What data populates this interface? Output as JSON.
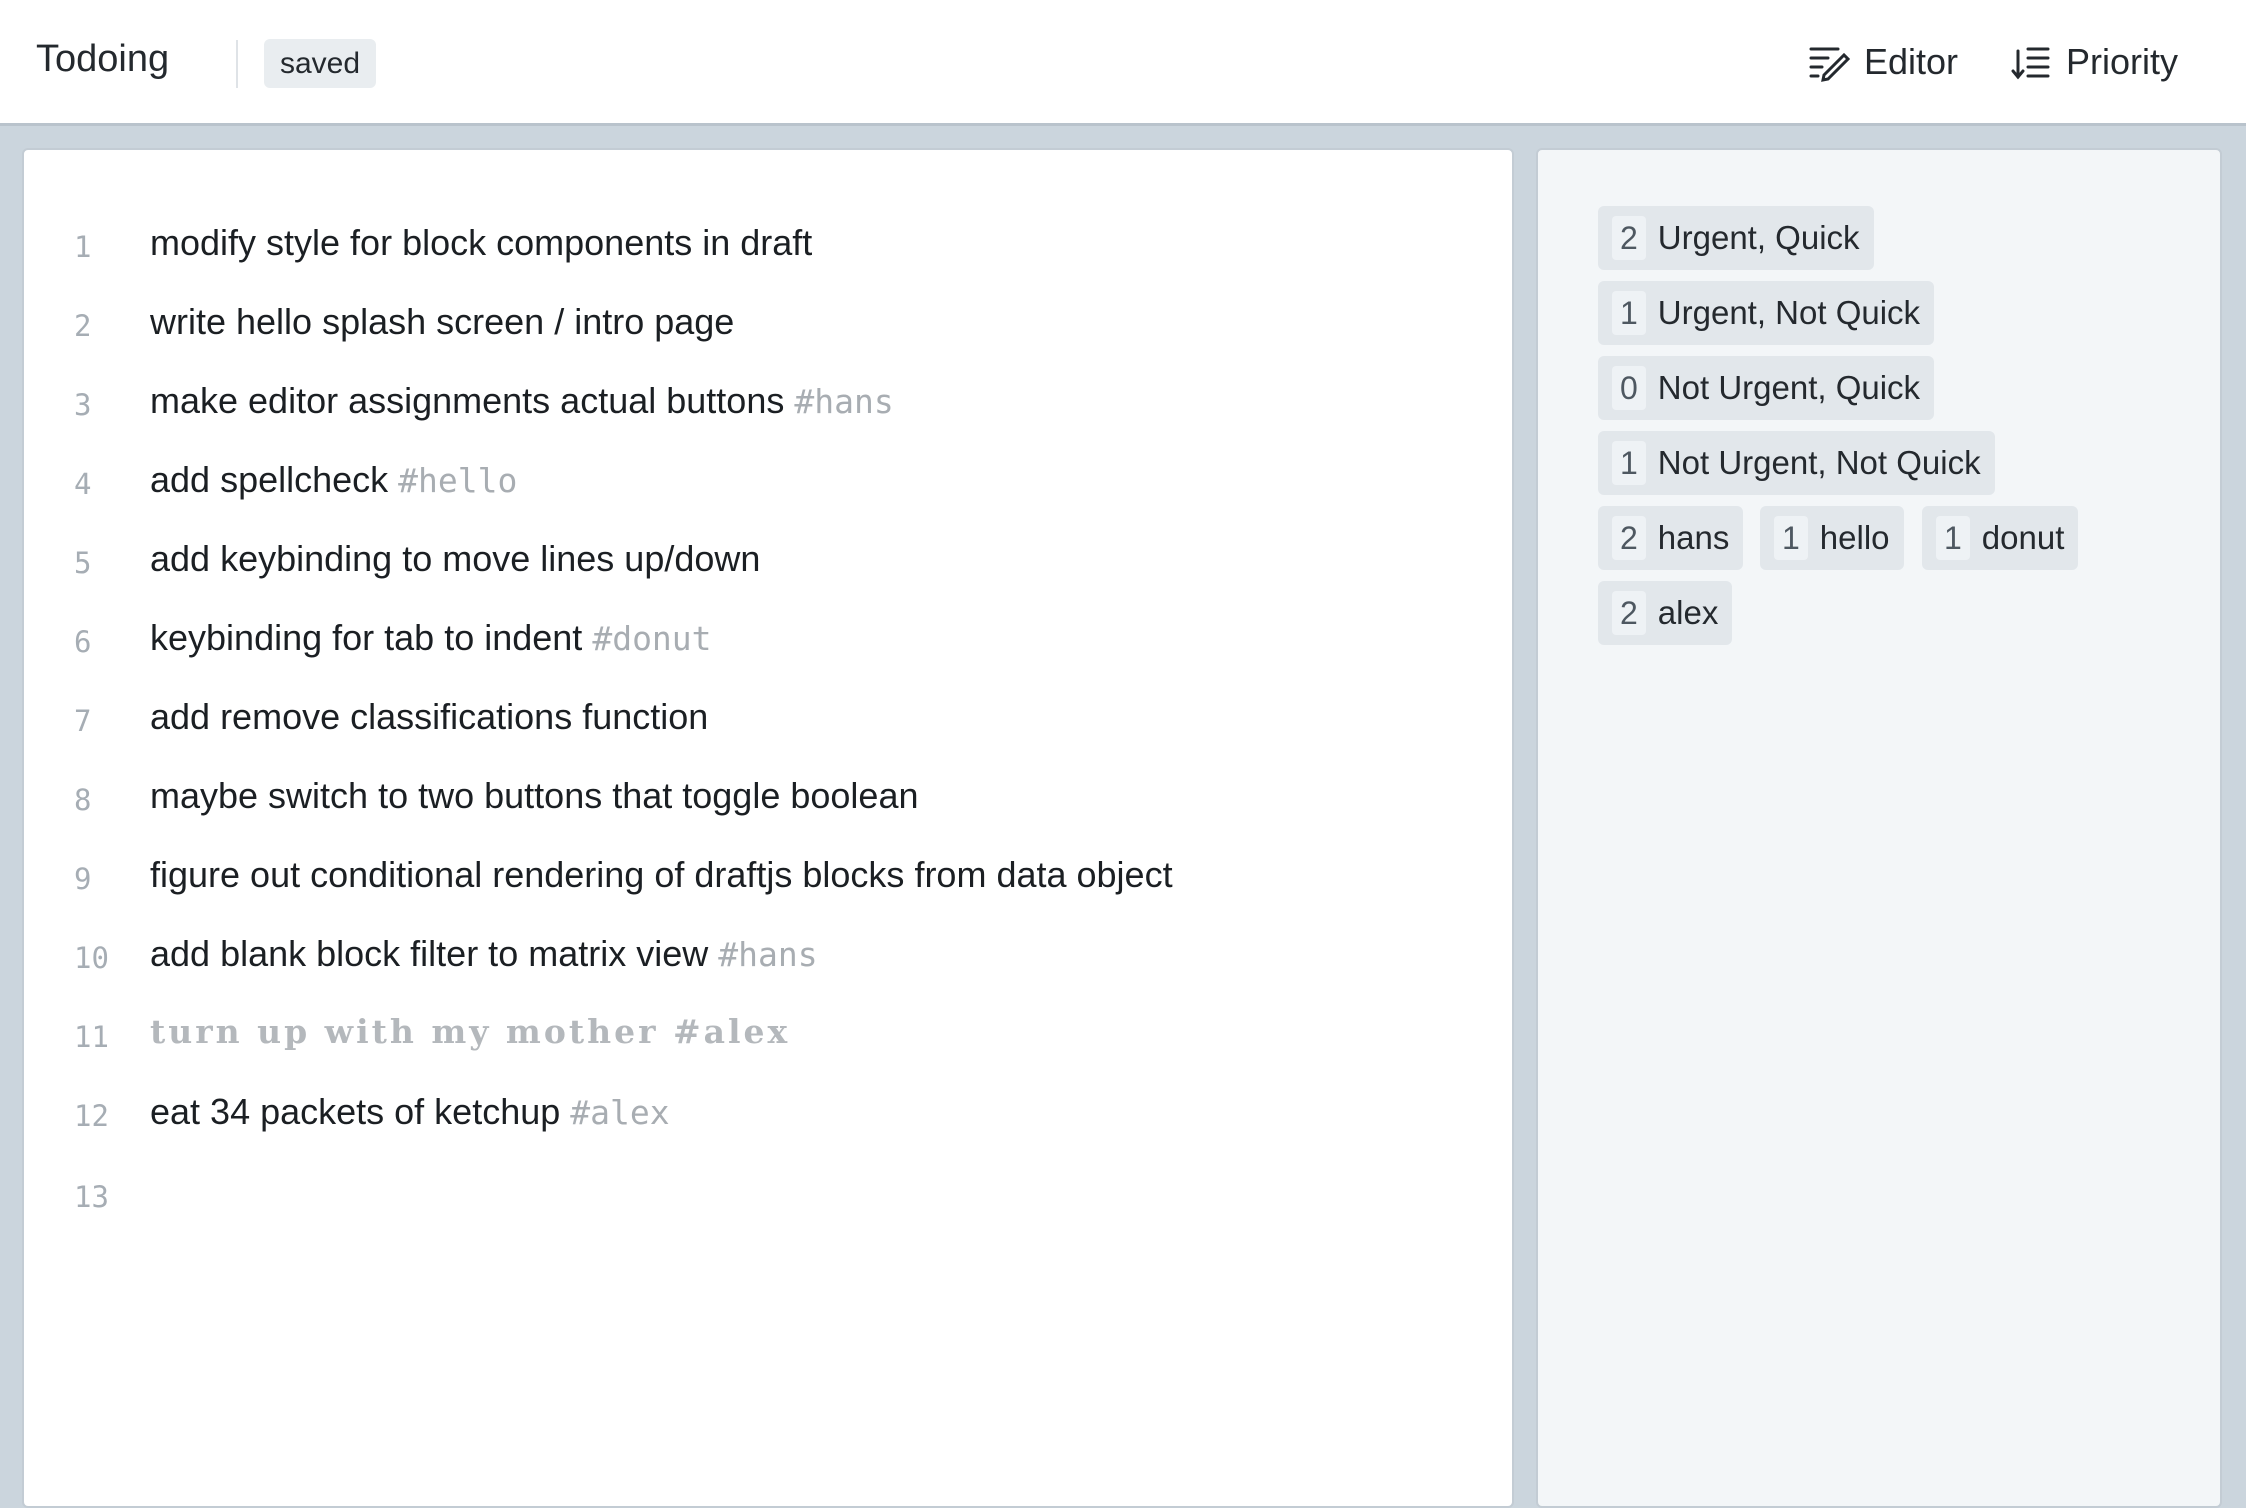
{
  "app": {
    "title": "Todoing",
    "status": "saved"
  },
  "nav": {
    "editor_label": "Editor",
    "priority_label": "Priority"
  },
  "lines": [
    {
      "num": "1",
      "text": "modify style for block components in draft",
      "tag": ""
    },
    {
      "num": "2",
      "text": "write hello splash screen / intro page",
      "tag": ""
    },
    {
      "num": "3",
      "text": "make editor assignments actual buttons",
      "tag": "#hans"
    },
    {
      "num": "4",
      "text": "add spellcheck",
      "tag": "#hello"
    },
    {
      "num": "5",
      "text": "add keybinding to move lines up/down",
      "tag": ""
    },
    {
      "num": "6",
      "text": "keybinding for tab to indent",
      "tag": "#donut"
    },
    {
      "num": "7",
      "text": "add remove classifications function",
      "tag": ""
    },
    {
      "num": "8",
      "text": "maybe switch to two buttons that toggle boolean",
      "tag": ""
    },
    {
      "num": "9",
      "text": "figure out conditional rendering of draftjs blocks from data object",
      "tag": ""
    },
    {
      "num": "10",
      "text": "add blank block filter to matrix view",
      "tag": "#hans"
    },
    {
      "num": "11",
      "text": "turn up with my mother #alex",
      "tag": ""
    },
    {
      "num": "12",
      "text": "eat 34 packets of ketchup",
      "tag": "#alex"
    },
    {
      "num": "13",
      "text": "",
      "tag": ""
    }
  ],
  "filters": [
    {
      "count": "2",
      "label": "Urgent, Quick"
    },
    {
      "count": "1",
      "label": "Urgent, Not Quick"
    },
    {
      "count": "0",
      "label": "Not Urgent, Quick"
    },
    {
      "count": "1",
      "label": "Not Urgent, Not Quick"
    },
    {
      "count": "2",
      "label": "hans"
    },
    {
      "count": "1",
      "label": "hello"
    },
    {
      "count": "1",
      "label": "donut"
    },
    {
      "count": "2",
      "label": "alex"
    }
  ]
}
